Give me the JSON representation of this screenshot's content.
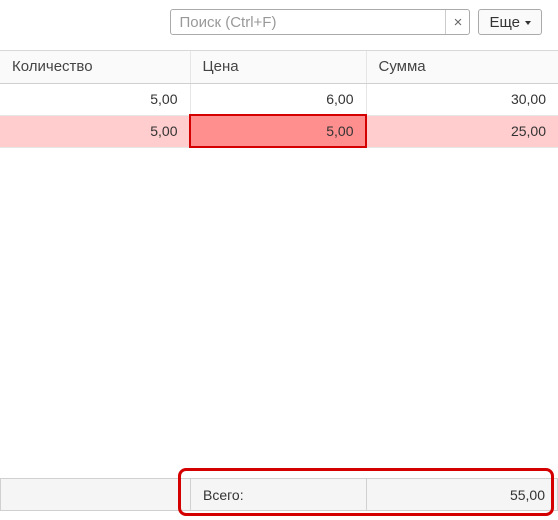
{
  "toolbar": {
    "search_placeholder": "Поиск (Ctrl+F)",
    "search_value": "",
    "clear_glyph": "×",
    "more_label": "Еще"
  },
  "columns": {
    "qty": "Количество",
    "price": "Цена",
    "sum": "Сумма"
  },
  "rows": [
    {
      "qty": "5,00",
      "price": "6,00",
      "sum": "30,00",
      "highlight": false,
      "price_error": false
    },
    {
      "qty": "5,00",
      "price": "5,00",
      "sum": "25,00",
      "highlight": true,
      "price_error": true
    }
  ],
  "footer": {
    "total_label": "Всего:",
    "total_value": "55,00"
  },
  "chart_data": {
    "type": "table",
    "columns": [
      "Количество",
      "Цена",
      "Сумма"
    ],
    "rows": [
      [
        5.0,
        6.0,
        30.0
      ],
      [
        5.0,
        5.0,
        25.0
      ]
    ],
    "total": 55.0
  }
}
